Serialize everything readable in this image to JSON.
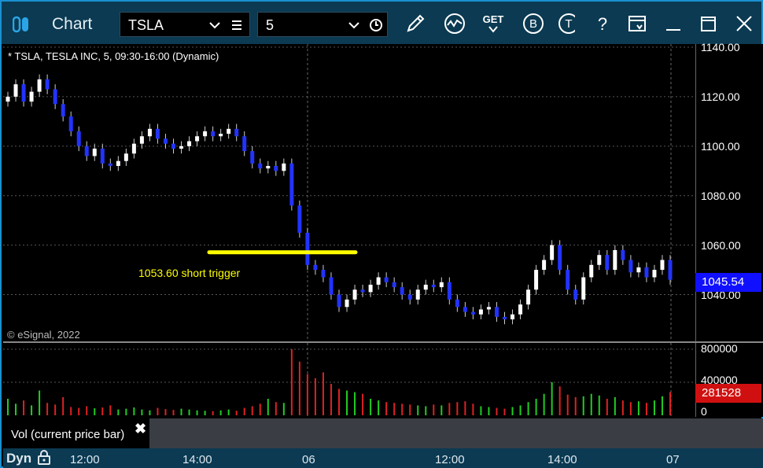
{
  "window": {
    "title": "Chart"
  },
  "toolbar": {
    "symbol": "TSLA",
    "interval": "5",
    "get_label": "GET",
    "b_label": "B",
    "t_label": "T",
    "help_label": "?"
  },
  "chart": {
    "header": "* TSLA, TESLA INC, 5, 09:30-16:00 (Dynamic)",
    "copyright": "© eSignal, 2022",
    "annotation": "1053.60 short trigger",
    "last_price": "1045.54",
    "price_ticks": [
      "1140.00",
      "1120.00",
      "1100.00",
      "1080.00",
      "1060.00",
      "1040.00"
    ]
  },
  "volume": {
    "ticks": [
      "800000",
      "400000",
      "0"
    ],
    "last": "281528",
    "study_label": "Vol (current price bar)",
    "close_glyph": "✖"
  },
  "time_axis": {
    "mode": "Dyn",
    "ticks": [
      "12:00",
      "14:00",
      "06",
      "12:00",
      "14:00",
      "07"
    ]
  },
  "colors": {
    "up_candle": "#ffffff",
    "down_candle": "#2233ff",
    "trigger_line": "#ffff00",
    "vol_up": "#22cc22",
    "vol_down": "#dd2222"
  },
  "chart_data": {
    "type": "candlestick",
    "ylim": [
      1030,
      1140
    ],
    "closes": [
      1120,
      1125,
      1118,
      1122,
      1127,
      1123,
      1117,
      1112,
      1106,
      1100,
      1096,
      1099,
      1093,
      1092,
      1094,
      1097,
      1101,
      1104,
      1107,
      1103,
      1101,
      1099,
      1100,
      1102,
      1104,
      1106,
      1104,
      1105,
      1107,
      1104,
      1098,
      1093,
      1091,
      1092,
      1090,
      1093,
      1076,
      1065,
      1052,
      1050,
      1047,
      1040,
      1035,
      1038,
      1042,
      1041,
      1044,
      1047,
      1045,
      1043,
      1040,
      1038,
      1042,
      1044,
      1043,
      1045,
      1038,
      1035,
      1033,
      1032,
      1034,
      1035,
      1031,
      1030,
      1032,
      1036,
      1042,
      1050,
      1054,
      1060,
      1050,
      1042,
      1038,
      1047,
      1052,
      1056,
      1050,
      1058,
      1054,
      1049,
      1051,
      1047,
      1050,
      1054,
      1046
    ],
    "volumes": [
      200000,
      140000,
      180000,
      120000,
      300000,
      150000,
      130000,
      220000,
      100000,
      90000,
      110000,
      85000,
      95000,
      120000,
      70000,
      80000,
      95000,
      70000,
      60000,
      90000,
      75000,
      65000,
      80000,
      70000,
      60000,
      55000,
      50000,
      60000,
      70000,
      55000,
      90000,
      110000,
      140000,
      200000,
      160000,
      150000,
      800000,
      650000,
      500000,
      450000,
      520000,
      380000,
      320000,
      300000,
      280000,
      260000,
      200000,
      180000,
      160000,
      150000,
      140000,
      130000,
      120000,
      110000,
      130000,
      120000,
      150000,
      160000,
      170000,
      140000,
      110000,
      100000,
      90000,
      80000,
      100000,
      120000,
      160000,
      200000,
      260000,
      400000,
      350000,
      250000,
      220000,
      230000,
      260000,
      240000,
      200000,
      220000,
      180000,
      160000,
      170000,
      150000,
      180000,
      230000,
      281528
    ]
  }
}
